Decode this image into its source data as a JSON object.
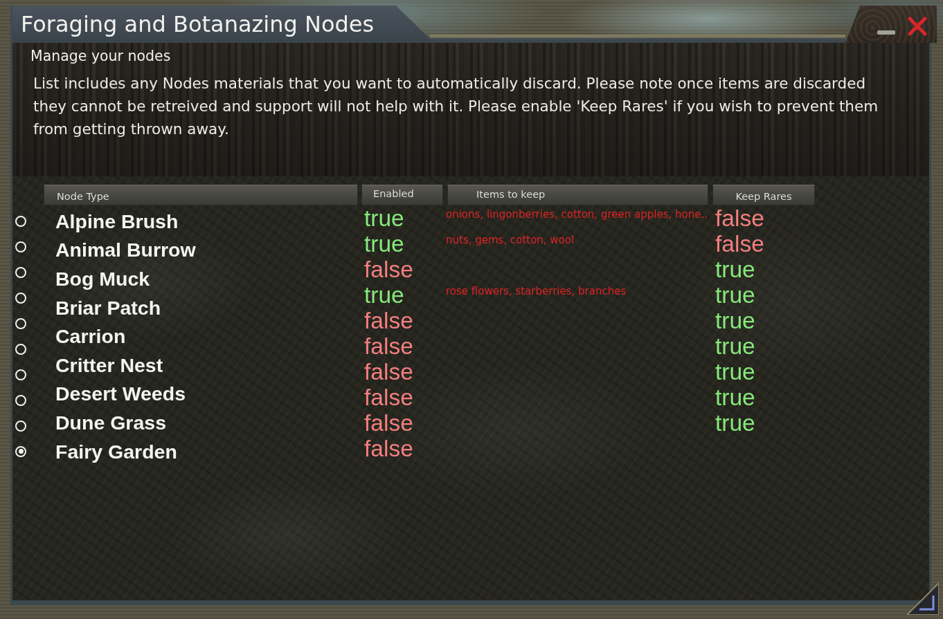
{
  "window": {
    "title": "Foraging and Botanazing Nodes",
    "subtitle": "Manage your nodes",
    "description": "List includes any Nodes materials that you want to automatically discard. Please note once items are discarded they cannot be retreived and support will not help with it. Please enable 'Keep Rares' if you wish to prevent them from getting thrown away."
  },
  "table": {
    "columns": [
      "Node Type",
      "Enabled",
      "Items to keep",
      "Keep Rares"
    ],
    "node_types": [
      "Alpine Brush",
      "Animal Burrow",
      "Bog Muck",
      "Briar Patch",
      "Carrion",
      "Critter Nest",
      "Desert Weeds",
      "Dune Grass",
      "Fairy Garden"
    ],
    "rows": [
      {
        "selected": false,
        "enabled": {
          "text": "true",
          "on": true
        },
        "items_to_keep": "onions, lingonberries, cotton, green apples, hone..",
        "keep_rares": {
          "text": "false",
          "on": false
        }
      },
      {
        "selected": false,
        "enabled": {
          "text": "true",
          "on": true
        },
        "items_to_keep": "nuts, gems, cotton, wool",
        "keep_rares": {
          "text": "false",
          "on": false
        }
      },
      {
        "selected": false,
        "enabled": {
          "text": "false",
          "on": false
        },
        "keep_rares": {
          "text": "true",
          "on": true
        }
      },
      {
        "selected": false,
        "enabled": {
          "text": "true",
          "on": true
        },
        "items_to_keep": "rose flowers, starberries, branches",
        "keep_rares": {
          "text": "true",
          "on": true
        }
      },
      {
        "selected": false,
        "enabled": {
          "text": "false",
          "on": false
        },
        "keep_rares": {
          "text": "true",
          "on": true
        }
      },
      {
        "selected": false,
        "enabled": {
          "text": "false",
          "on": false
        },
        "keep_rares": {
          "text": "true",
          "on": true
        }
      },
      {
        "selected": false,
        "enabled": {
          "text": "false",
          "on": false
        },
        "keep_rares": {
          "text": "true",
          "on": true
        }
      },
      {
        "selected": false,
        "enabled": {
          "text": "false",
          "on": false
        },
        "keep_rares": {
          "text": "true",
          "on": true
        }
      },
      {
        "selected": false,
        "enabled": {
          "text": "false",
          "on": false
        },
        "keep_rares": {
          "text": "true",
          "on": true
        }
      },
      {
        "selected": true,
        "enabled": {
          "text": "false",
          "on": false
        }
      }
    ]
  }
}
